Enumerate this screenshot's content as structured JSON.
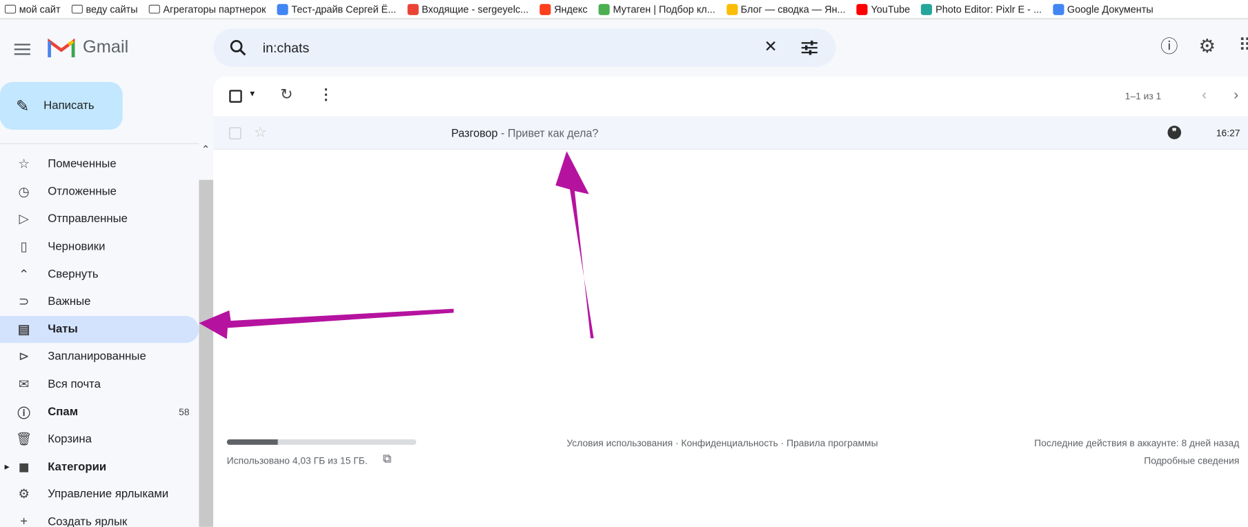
{
  "bookmarks": [
    {
      "label": "мой  сайт",
      "icon": "folder-icon"
    },
    {
      "label": "веду сайты",
      "icon": "folder-icon"
    },
    {
      "label": "Агрегаторы партнерок",
      "icon": "folder-icon"
    },
    {
      "label": "Тест-драйв Сергей Ё...",
      "icon": "google-docs-icon",
      "color": "#4285f4"
    },
    {
      "label": "Входящие - sergeyelc...",
      "icon": "gmail-icon",
      "color": "#ea4335"
    },
    {
      "label": "Яндекс",
      "icon": "yandex-icon",
      "color": "#fc3f1d"
    },
    {
      "label": "Мутаген | Подбор кл...",
      "icon": "mutagen-icon",
      "color": "#4caf50"
    },
    {
      "label": "Блог — сводка — Ян...",
      "icon": "blog-icon",
      "color": "#fbbc04"
    },
    {
      "label": "YouTube",
      "icon": "youtube-icon",
      "color": "#ff0000"
    },
    {
      "label": "Photo Editor: Pixlr E - ...",
      "icon": "pixlr-icon",
      "color": "#26a69a"
    },
    {
      "label": "Google Документы",
      "icon": "google-docs-icon",
      "color": "#4285f4"
    }
  ],
  "header": {
    "app_name": "Gmail",
    "search_value": "in:chats"
  },
  "compose_label": "Написать",
  "sidebar": {
    "items": [
      {
        "label": "Помеченные",
        "icon": "star-icon",
        "glyph": "☆"
      },
      {
        "label": "Отложенные",
        "icon": "clock-icon",
        "glyph": "◷"
      },
      {
        "label": "Отправленные",
        "icon": "send-icon",
        "glyph": "▷"
      },
      {
        "label": "Черновики",
        "icon": "draft-icon",
        "glyph": "▯"
      },
      {
        "label": "Свернуть",
        "icon": "chevron-up-icon",
        "glyph": "⌃"
      },
      {
        "label": "Важные",
        "icon": "important-icon",
        "glyph": "⊃"
      },
      {
        "label": "Чаты",
        "icon": "chat-icon",
        "glyph": "▤",
        "active": true
      },
      {
        "label": "Запланированные",
        "icon": "scheduled-icon",
        "glyph": "⊳"
      },
      {
        "label": "Вся почта",
        "icon": "mail-icon",
        "glyph": "✉"
      },
      {
        "label": "Спам",
        "icon": "spam-icon",
        "glyph": "ⓘ",
        "count": "58",
        "bold": true
      },
      {
        "label": "Корзина",
        "icon": "trash-icon",
        "glyph": "🗑"
      },
      {
        "label": "Категории",
        "icon": "label-icon",
        "glyph": "◼",
        "bold": true
      },
      {
        "label": "Управление ярлыками",
        "icon": "gear-icon",
        "glyph": "⚙"
      },
      {
        "label": "Создать ярлык",
        "icon": "plus-icon",
        "glyph": "+"
      }
    ]
  },
  "toolbar": {
    "pagination": "1–1 из 1"
  },
  "messages": [
    {
      "sender": "Разговор",
      "snippet": " - Привет как дела?",
      "time": "16:27",
      "starred": false
    }
  ],
  "footer": {
    "storage_text": "Использовано 4,03 ГБ из 15 ГБ.",
    "storage_used_fraction": 0.27,
    "links": "Условия использования · Конфиденциальность · Правила программы",
    "activity": "Последние действия в аккаунте: 8 дней назад",
    "details": "Подробные сведения"
  },
  "colors": {
    "accent_arrow": "#b5139f",
    "active_nav": "#d3e3fd",
    "compose": "#c2e7ff"
  }
}
